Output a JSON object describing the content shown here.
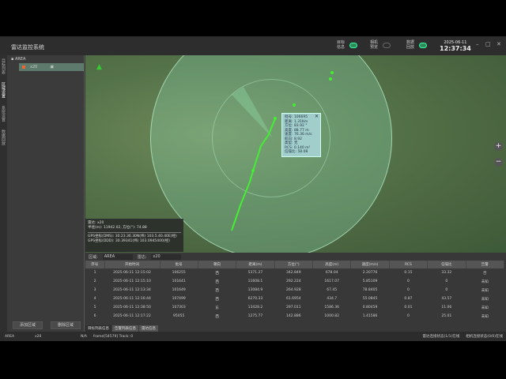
{
  "header": {
    "title": "雷达监控系统",
    "toggles": [
      {
        "label": "目标信息",
        "on": true
      },
      {
        "label": "相机预览",
        "on": false
      },
      {
        "label": "数据回放",
        "on": true
      }
    ],
    "date": "2025-06-11",
    "time": "12:37:34",
    "minimize": "–",
    "maximize": "□",
    "close": "✕"
  },
  "left_tabs": [
    "目标列表",
    "区域设置",
    "系统设置",
    "数据回放"
  ],
  "tree": {
    "root": "AREA",
    "child": "x20"
  },
  "left_buttons": [
    "添加区域",
    "删除区域"
  ],
  "popup": {
    "lines": [
      "批号: 106695",
      "距离: 1.31Km",
      "方位: 83.92 °",
      "高度: 88.77 m",
      "速度: 76.36 m/s",
      "航向: 8.92",
      "类型: 无",
      "RCS: 0.140 m²",
      "信噪比: 58.08"
    ]
  },
  "infobox": {
    "lines": [
      "雷达: x20",
      "半径(m): 11942.02, 方位(°): 74.88"
    ],
    "gps": [
      "GPS坐标(DMS): 30.23.36.30N(纬) 103.5.40.40E(经)",
      "GPS坐标(DDD): 30.39341(纬) 103.0945400(经)"
    ]
  },
  "map": {
    "zoom_in": "+",
    "zoom_out": "−",
    "north": "▲"
  },
  "table": {
    "filter_area_label": "区域:",
    "filter_area": "AREA",
    "filter_radar_label": "雷达:",
    "filter_radar": "x20",
    "columns": [
      "序号",
      "开始时间",
      "批号",
      "朝向",
      "距离(m)",
      "方位(°)",
      "高度(m)",
      "速度(m/s)",
      "RCS",
      "信噪比",
      "告警"
    ],
    "rows": [
      [
        "1",
        "2025-06-11 12:15:02",
        "106255",
        "西",
        "5371.27",
        "342.849",
        "678.04",
        "2.20776",
        "0.15",
        "33.32",
        "否"
      ],
      [
        "2",
        "2025-06-11 12:15:10",
        "101641",
        "西",
        "11608.1",
        "292.224",
        "1617.07",
        "5.85109",
        "0",
        "0",
        "未知"
      ],
      [
        "3",
        "2025-06-11 12:13:34",
        "101649",
        "西",
        "13084.9",
        "264.928",
        "67.45",
        "78.8405",
        "0",
        "0",
        "未知"
      ],
      [
        "4",
        "2025-06-11 12:16:44",
        "107499",
        "西",
        "6270.33",
        "61.6954",
        "434.7",
        "55.0845",
        "0.87",
        "43.57",
        "未知"
      ],
      [
        "5",
        "2025-06-11 12:38:50",
        "107303",
        "东",
        "13428.2",
        "297.011",
        "1586.36",
        "0.80459",
        "0.01",
        "11.06",
        "未知"
      ],
      [
        "6",
        "2025-06-11 12:17:22",
        "95055",
        "西",
        "1275.77",
        "142.886",
        "1000.82",
        "1.41586",
        "0",
        "25.01",
        "未知"
      ]
    ],
    "tabs": [
      "目标列表信息",
      "告警列表信息",
      "雷达信息"
    ]
  },
  "status": {
    "area": "AREA",
    "radar": "x20",
    "na": "N/A",
    "frame": "frame[54579] Track: 0",
    "right1": "雷达连接状态(1/1)在线",
    "right2": "相机连接状态(0/0)在线"
  },
  "colors": {
    "track": "#44ee33",
    "accent": "#2e8b57"
  }
}
